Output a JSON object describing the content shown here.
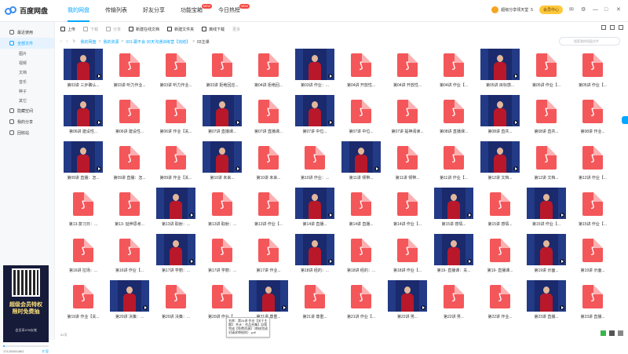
{
  "app": {
    "name": "百度网盘"
  },
  "nav": [
    {
      "label": "我的网盘",
      "active": true
    },
    {
      "label": "传输列表"
    },
    {
      "label": "好友分享"
    },
    {
      "label": "功能宝箱",
      "badge": "NEW"
    },
    {
      "label": "今日热榜",
      "badge": "NEW"
    }
  ],
  "header": {
    "promo": "超级分享领天堂",
    "promo_count": "5",
    "vip": "会员中心"
  },
  "sidebar": {
    "items": [
      {
        "label": "最近使用"
      },
      {
        "label": "全部文件",
        "active": true
      }
    ],
    "subs": [
      "图片",
      "视频",
      "文档",
      "音乐",
      "种子",
      "其它"
    ],
    "extra": [
      "隐藏空间",
      "我的分享",
      "回收站"
    ]
  },
  "ad": {
    "line1": "超级会员特权",
    "line2": "限时免费抽",
    "note": "会员享4TB存储"
  },
  "storage": {
    "used": "174.3G/6146G",
    "expand": "扩容",
    "fraction": 0.03
  },
  "toolbar": {
    "upload": "上传",
    "download": "下载",
    "share": "分享",
    "new_doc": "新建在线文档",
    "new_folder": "新建文件夹",
    "offline": "离线下载",
    "more": "更多"
  },
  "path": {
    "crumbs": [
      "我的网盘",
      "我的资源",
      "001.跟不会 30天沟通训练营【完结】",
      "03主课"
    ],
    "search_placeholder": "搜索我的网盘文件"
  },
  "files": [
    {
      "t": "v",
      "c": "第03讲 三步确认..."
    },
    {
      "t": "p",
      "c": "第03讲 听力作业..."
    },
    {
      "t": "p",
      "c": "第03讲 听力作业..."
    },
    {
      "t": "p",
      "c": "第03讲 拒绝回应..."
    },
    {
      "t": "p",
      "c": "第04讲 拒绝回..."
    },
    {
      "t": "v",
      "c": "第03讲 作业：..."
    },
    {
      "t": "p",
      "c": "第04讲 开放性..."
    },
    {
      "t": "p",
      "c": "第04讲 开放性..."
    },
    {
      "t": "p",
      "c": "第04讲 作业【..."
    },
    {
      "t": "v",
      "c": "第05讲 目标感..."
    },
    {
      "t": "p",
      "c": "第05讲 作业【..."
    },
    {
      "t": "p",
      "c": "第05讲 作业【..."
    },
    {
      "t": "v",
      "c": "第06讲 建设性..."
    },
    {
      "t": "p",
      "c": "第06讲 建设性..."
    },
    {
      "t": "p",
      "c": "第06讲 作业【关..."
    },
    {
      "t": "v",
      "c": "第07讲 直播课..."
    },
    {
      "t": "p",
      "c": "第07讲 直播课..."
    },
    {
      "t": "v",
      "c": "第07讲 中位..."
    },
    {
      "t": "p",
      "c": "第07讲 中位..."
    },
    {
      "t": "p",
      "c": "第07讲 提神阅读..."
    },
    {
      "t": "p",
      "c": "第08讲 直播课..."
    },
    {
      "t": "v",
      "c": "第08讲 直共..."
    },
    {
      "t": "p",
      "c": "第08讲 直共..."
    },
    {
      "t": "p",
      "c": "第08讲 作业..."
    },
    {
      "t": "v",
      "c": "第09讲 直播：怎..."
    },
    {
      "t": "p",
      "c": "第09讲 直播：怎..."
    },
    {
      "t": "p",
      "c": "第09讲 作业【关..."
    },
    {
      "t": "v",
      "c": "第10讲 未来..."
    },
    {
      "t": "p",
      "c": "第10讲 未来..."
    },
    {
      "t": "p",
      "c": "第10讲 作业：..."
    },
    {
      "t": "v",
      "c": "第11讲 倾带..."
    },
    {
      "t": "p",
      "c": "第11讲 倾带..."
    },
    {
      "t": "p",
      "c": "第11讲 作业【..."
    },
    {
      "t": "v",
      "c": "第12讲 文档..."
    },
    {
      "t": "p",
      "c": "第12讲 文档..."
    },
    {
      "t": "p",
      "c": "第12讲 作业【..."
    },
    {
      "t": "p",
      "c": "第13-复习日：..."
    },
    {
      "t": "p",
      "c": "第13- 延伸思考..."
    },
    {
      "t": "v",
      "c": "第13讲 取射：..."
    },
    {
      "t": "p",
      "c": "第13讲 取射：..."
    },
    {
      "t": "p",
      "c": "第13讲 作业【..."
    },
    {
      "t": "v",
      "c": "第14讲 直播..."
    },
    {
      "t": "p",
      "c": "第14讲 直播..."
    },
    {
      "t": "p",
      "c": "第14讲 作业【..."
    },
    {
      "t": "v",
      "c": "第15讲 感情..."
    },
    {
      "t": "p",
      "c": "第15讲 感情..."
    },
    {
      "t": "v",
      "c": "第15讲 作业【..."
    },
    {
      "t": "p",
      "c": "第15讲 作业【..."
    },
    {
      "t": "p",
      "c": "第16讲 拉场：..."
    },
    {
      "t": "p",
      "c": "第16讲 作业【..."
    },
    {
      "t": "v",
      "c": "第17讲 学丽：..."
    },
    {
      "t": "p",
      "c": "第17讲 学丽：..."
    },
    {
      "t": "p",
      "c": "第17讲 作业..."
    },
    {
      "t": "v",
      "c": "第18讲 经的：..."
    },
    {
      "t": "p",
      "c": "第18讲 经的：..."
    },
    {
      "t": "p",
      "c": "第18讲 作业【..."
    },
    {
      "t": "v",
      "c": "第19- 直播课：关..."
    },
    {
      "t": "p",
      "c": "第19- 直播课..."
    },
    {
      "t": "v",
      "c": "第19讲 示面..."
    },
    {
      "t": "p",
      "c": "第19讲 示面..."
    },
    {
      "t": "p",
      "c": "第19讲 作业【关..."
    },
    {
      "t": "v",
      "c": "第20讲 决策：..."
    },
    {
      "t": "p",
      "c": "第20讲 决策：..."
    },
    {
      "t": "p",
      "c": "第20讲 作业【..."
    },
    {
      "t": "v",
      "c": "第21讲 尊重..."
    },
    {
      "t": "p",
      "c": "第21讲 尊重..."
    },
    {
      "t": "p",
      "c": "第21讲 作业【..."
    },
    {
      "t": "v",
      "c": "第22讲 男..."
    },
    {
      "t": "p",
      "c": "第22讲 男..."
    },
    {
      "t": "p",
      "c": "第22讲 作业..."
    },
    {
      "t": "v",
      "c": "第23讲 直播..."
    },
    {
      "t": "p",
      "c": "第23讲 直播..."
    },
    {
      "t": "p",
      "c": "第23讲 作业【关..."
    },
    {
      "t": "v",
      "c": "第24讲 MOT..."
    },
    {
      "t": "p",
      "c": "第24讲 MOT..."
    },
    {
      "t": "p",
      "c": "第24讲 作业..."
    },
    {
      "t": "v",
      "c": "第25讲 直播..."
    },
    {
      "t": "p",
      "c": "第25 第3次..."
    },
    {
      "t": "p",
      "c": "第25 第3次直播..."
    },
    {
      "t": "p",
      "c": "第25 结业考试【..."
    },
    {
      "t": "p",
      "c": "第26 结业扎包..."
    },
    {
      "t": "p",
      "c": "第27 加餐1包..."
    },
    {
      "t": "p",
      "c": "第28 加餐2包..."
    },
    {
      "t": "p",
      "c": "第30 结业证书..."
    }
  ],
  "tooltip": "名称：第24讲 作业【关于主题】 共计：作品合集】自我完成【免费资源】（审核完成对请求审核的）.pdf",
  "status": "84项"
}
